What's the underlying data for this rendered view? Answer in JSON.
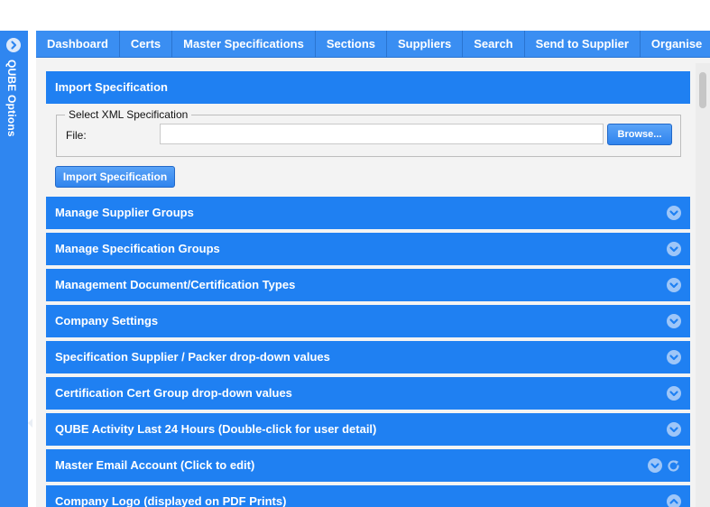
{
  "side_rail": {
    "label": "QUBE Options",
    "toggle_icon": "chevron-right-circle-icon"
  },
  "nav": {
    "tabs": [
      {
        "label": "Dashboard"
      },
      {
        "label": "Certs"
      },
      {
        "label": "Master Specifications"
      },
      {
        "label": "Sections"
      },
      {
        "label": "Suppliers"
      },
      {
        "label": "Search"
      },
      {
        "label": "Send to Supplier"
      },
      {
        "label": "Organise"
      }
    ]
  },
  "import_panel": {
    "title": "Import Specification",
    "fieldset_legend": "Select XML Specification",
    "file_label": "File:",
    "file_value": "",
    "browse_label": "Browse...",
    "import_button_label": "Import Specification"
  },
  "panels": [
    {
      "label": "Manage Supplier Groups",
      "icon": "chevron-down-circle-icon"
    },
    {
      "label": "Manage Specification Groups",
      "icon": "chevron-down-circle-icon"
    },
    {
      "label": "Management Document/Certification Types",
      "icon": "chevron-down-circle-icon"
    },
    {
      "label": "Company Settings",
      "icon": "chevron-down-circle-icon"
    },
    {
      "label": "Specification Supplier / Packer drop-down values",
      "icon": "chevron-down-circle-icon"
    },
    {
      "label": "Certification Cert Group drop-down values",
      "icon": "chevron-down-circle-icon"
    },
    {
      "label": "QUBE Activity Last 24 Hours (Double-click for user detail)",
      "icon": "chevron-down-circle-icon"
    },
    {
      "label": "Master Email Account (Click to edit)",
      "icon": "chevron-down-circle-icon",
      "extra_icon": "refresh-icon"
    },
    {
      "label": "Company Logo (displayed on PDF Prints)",
      "icon": "chevron-up-circle-icon"
    }
  ],
  "colors": {
    "accent": "#1f80f2",
    "nav": "#3a8ef2",
    "rail": "#2f86f0",
    "background": "#f3f3f3"
  }
}
